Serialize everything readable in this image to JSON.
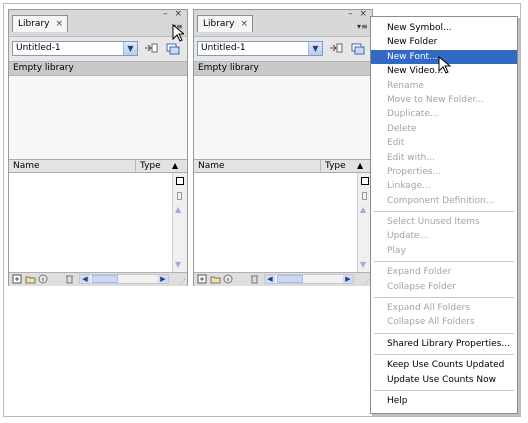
{
  "panels": [
    {
      "tab_label": "Library",
      "document": "Untitled-1",
      "status": "Empty library",
      "col_name": "Name",
      "col_type": "Type"
    },
    {
      "tab_label": "Library",
      "document": "Untitled-1",
      "status": "Empty library",
      "col_name": "Name",
      "col_type": "Type"
    }
  ],
  "context_menu": {
    "items": [
      {
        "label": "New Symbol...",
        "enabled": true
      },
      {
        "label": "New Folder",
        "enabled": true
      },
      {
        "label": "New Font...",
        "enabled": true,
        "highlighted": true
      },
      {
        "label": "New Video...",
        "enabled": true
      },
      {
        "label": "Rename",
        "enabled": false
      },
      {
        "label": "Move to New Folder...",
        "enabled": false
      },
      {
        "label": "Duplicate...",
        "enabled": false
      },
      {
        "label": "Delete",
        "enabled": false
      },
      {
        "label": "Edit",
        "enabled": false
      },
      {
        "label": "Edit with...",
        "enabled": false
      },
      {
        "label": "Properties...",
        "enabled": false
      },
      {
        "label": "Linkage...",
        "enabled": false
      },
      {
        "label": "Component Definition...",
        "enabled": false
      },
      {
        "label": "Select Unused Items",
        "enabled": false
      },
      {
        "label": "Update...",
        "enabled": false
      },
      {
        "label": "Play",
        "enabled": false
      },
      {
        "label": "Expand Folder",
        "enabled": false
      },
      {
        "label": "Collapse Folder",
        "enabled": false
      },
      {
        "label": "Expand All Folders",
        "enabled": false
      },
      {
        "label": "Collapse All Folders",
        "enabled": false
      },
      {
        "label": "Shared Library Properties...",
        "enabled": true
      },
      {
        "label": "Keep Use Counts Updated",
        "enabled": true
      },
      {
        "label": "Update Use Counts Now",
        "enabled": true
      },
      {
        "label": "Help",
        "enabled": true
      }
    ]
  },
  "glyphs": {
    "tab_close": "×",
    "window_controls": "– ×",
    "panel_menu": "▾≡",
    "dropdown": "▼",
    "sort": "▲",
    "scroll_up": "▲",
    "scroll_down": "▼",
    "scroll_left": "◀",
    "scroll_right": "▶"
  },
  "colors": {
    "menu_highlight": "#316ac5",
    "disabled_text": "#a4a4a4"
  }
}
